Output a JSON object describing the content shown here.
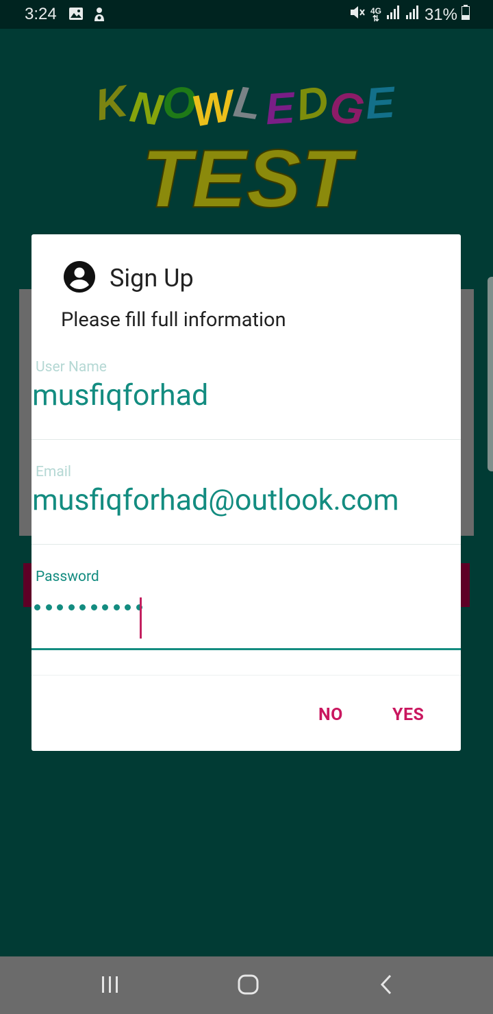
{
  "status_bar": {
    "time": "3:24",
    "network": "4G",
    "battery": "31%",
    "icons": [
      "gallery-icon",
      "usb-icon",
      "mute-icon",
      "4g-data-icon",
      "signal-icon",
      "signal-icon-2",
      "battery-icon"
    ]
  },
  "logo": {
    "line1": "KNOWLEDGE",
    "line2": "TEST",
    "line1_colors": [
      "#7b8412",
      "#86a40c",
      "#1f7a17",
      "#ecbf1b",
      "#7a8286",
      "#7a1e86",
      "#7d8d0c",
      "#8c1c68",
      "#13708a",
      "#c26d0f",
      "#8a1f5c",
      "#476862"
    ],
    "line2_color": "#8b8a0c"
  },
  "dialog": {
    "icon": "account-circle-icon",
    "title": "Sign Up",
    "message": "Please fill full information",
    "fields": {
      "username": {
        "label": "User Name",
        "value": "musfiqforhad"
      },
      "email": {
        "label": "Email",
        "value": "musfiqforhad@outlook.com"
      },
      "password": {
        "label": "Password",
        "masked_length": 10
      }
    },
    "buttons": {
      "no": "NO",
      "yes": "YES"
    }
  },
  "colors": {
    "app_background": "#013b34",
    "accent_teal": "#138c80",
    "accent_pink": "#c9175f",
    "status_bar": "#002420",
    "nav_bar": "#6b6b6b"
  },
  "nav_bar": {
    "icons": [
      "recent-apps-icon",
      "home-icon",
      "back-icon"
    ]
  }
}
